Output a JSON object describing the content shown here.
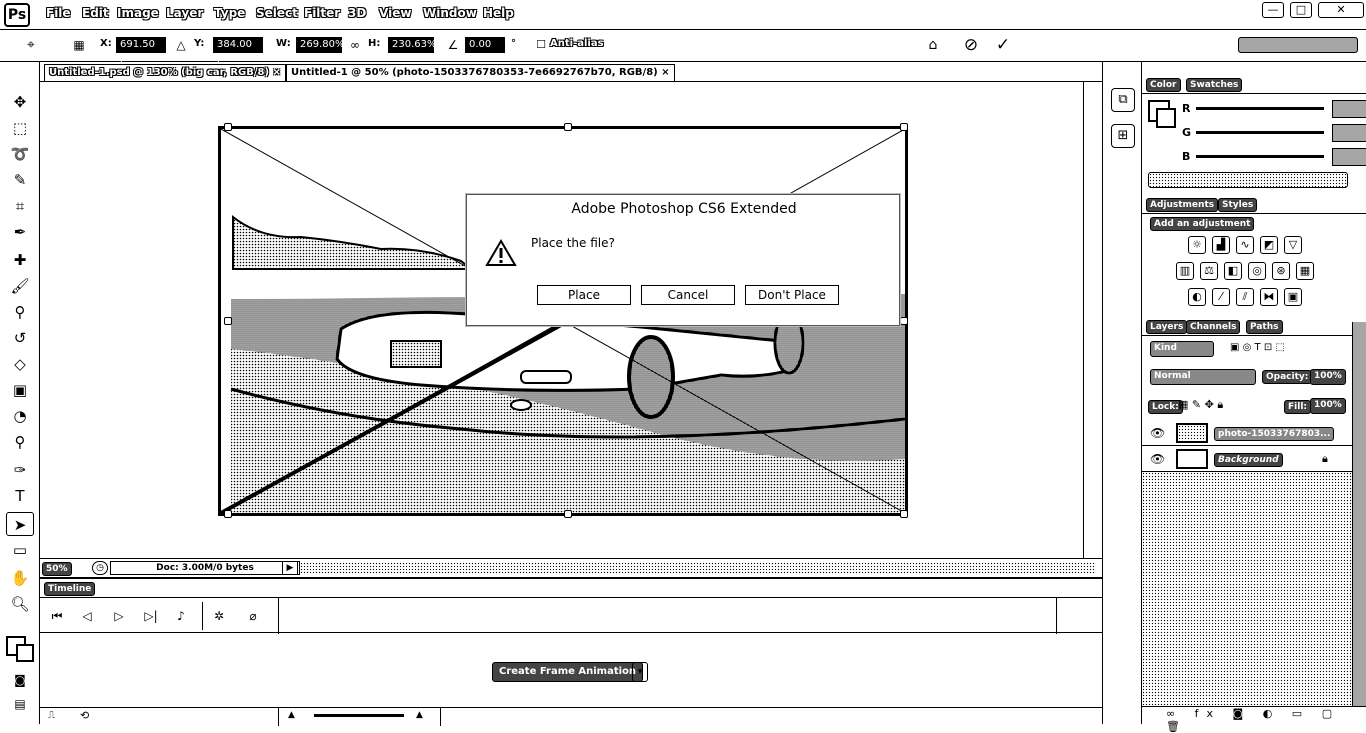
{
  "app": {
    "logo": "Ps"
  },
  "menubar": {
    "items": [
      "File",
      "Edit",
      "Image",
      "Layer",
      "Type",
      "Select",
      "Filter",
      "3D",
      "View",
      "Window",
      "Help"
    ],
    "window_controls": [
      "—",
      "□",
      "✕"
    ]
  },
  "options": {
    "x_label": "X:",
    "x_value": "691.50 px",
    "y_label": "Y:",
    "y_value": "384.00 px",
    "w_label": "W:",
    "w_value": "269.80%",
    "h_label": "H:",
    "h_value": "230.63%",
    "angle_value": "0.00",
    "angle_unit": "°",
    "antialias_label": "Anti-alias"
  },
  "tabs": [
    {
      "label": "Untitled-1.psd @ 130% (big car, RGB/8)",
      "close": "×"
    },
    {
      "label": "Untitled-1 @ 50% (photo-1503376780353-7e6692767b70, RGB/8)",
      "close": "×"
    }
  ],
  "dialog": {
    "title": "Adobe Photoshop CS6 Extended",
    "message": "Place the file?",
    "buttons": {
      "place": "Place",
      "cancel": "Cancel",
      "dont_place": "Don't Place"
    }
  },
  "statusbar": {
    "zoom": "50%",
    "doc": "Doc: 3.00M/0 bytes"
  },
  "timeline": {
    "tab": "Timeline",
    "create_button": "Create Frame Animation"
  },
  "panels": {
    "color_tabs": [
      "Color",
      "Swatches"
    ],
    "color_channels": [
      "R",
      "G",
      "B"
    ],
    "adjust_tabs": [
      "Adjustments",
      "Styles"
    ],
    "adjust_heading": "Add an adjustment",
    "layers_tabs": [
      "Layers",
      "Channels",
      "Paths"
    ],
    "kind_label": "Kind",
    "blend_mode": "Normal",
    "opacity_label": "Opacity:",
    "opacity_value": "100%",
    "lock_label": "Lock:",
    "fill_label": "Fill:",
    "fill_value": "100%",
    "layers": [
      {
        "name": "photo-15033767803..."
      },
      {
        "name": "Background"
      }
    ]
  },
  "colors": {
    "ink": "#000000",
    "paper": "#ffffff"
  }
}
